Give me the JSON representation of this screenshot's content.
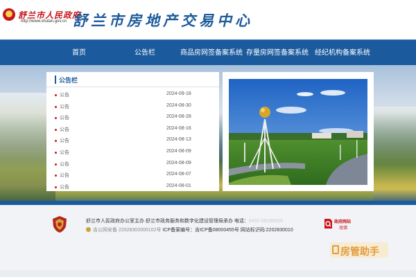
{
  "header": {
    "gov_name": "舒兰市人民政府",
    "gov_url": "http://www.shulan.gov.cn",
    "site_title": "舒兰市房地产交易中心"
  },
  "nav": {
    "items": [
      {
        "label": "首页"
      },
      {
        "label": "公告栏"
      },
      {
        "label": "商品房网签备案系统"
      },
      {
        "label": "存量房网签备案系统"
      },
      {
        "label": "经纪机构备案系统"
      }
    ]
  },
  "notice": {
    "title": "公告栏",
    "items": [
      {
        "title": "公告",
        "date": "2024-09-18"
      },
      {
        "title": "公告",
        "date": "2024-08-30"
      },
      {
        "title": "公告",
        "date": "2024-08-28"
      },
      {
        "title": "公告",
        "date": "2024-08-16"
      },
      {
        "title": "公告",
        "date": "2024-08-13"
      },
      {
        "title": "公告",
        "date": "2024-08-09"
      },
      {
        "title": "公告",
        "date": "2024-08-09"
      },
      {
        "title": "公告",
        "date": "2024-08-07"
      },
      {
        "title": "公告",
        "date": "2024-08-01"
      }
    ]
  },
  "footer": {
    "host_line": "舒兰市人民政府办公室主办 舒兰市政务服务和数字化建设管理局承办 电话：",
    "phone": "0432-68288009",
    "police_record": "吉公网安备 22028302000102号",
    "icp_record": "ICP备案编号：吉ICP备08000455号 网站标识码:2202830010",
    "find_site_line1": "政府网站",
    "find_site_line2": "找错",
    "assistant_label": "房管助手"
  },
  "colors": {
    "brand_blue": "#1b5a9c",
    "title_blue": "#1c5a9a",
    "gov_red": "#c8141b",
    "assistant_orange": "#e39a3c"
  }
}
